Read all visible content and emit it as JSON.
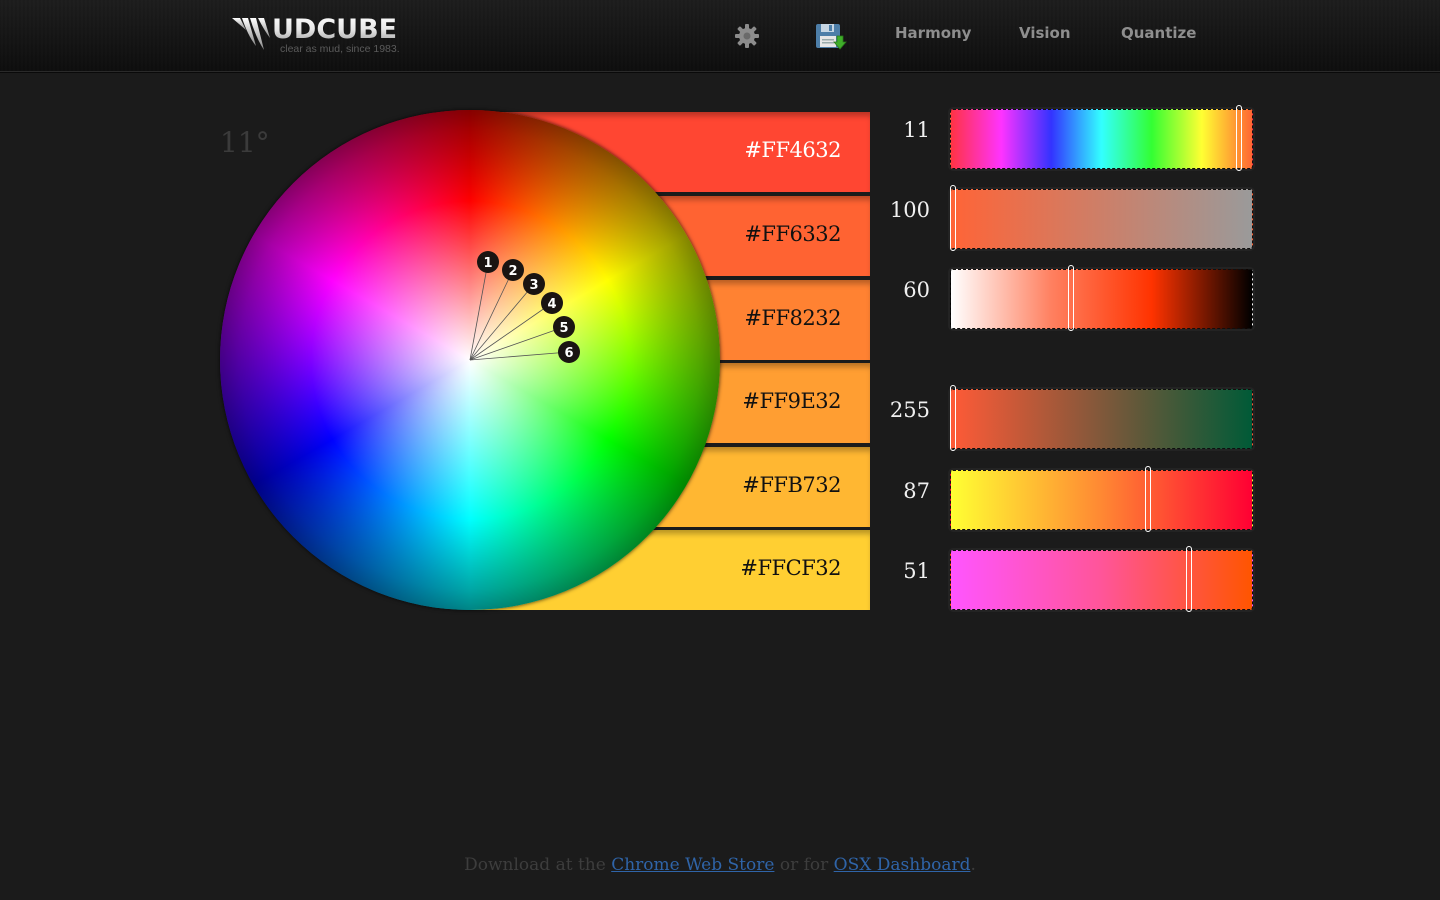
{
  "header": {
    "logo_text": "UDCUBE",
    "logo_tagline": "clear as mud, since 1983.",
    "icons": [
      {
        "name": "gear-icon",
        "label": "settings"
      },
      {
        "name": "save-icon",
        "label": "save / download"
      }
    ],
    "nav": [
      {
        "label": "Harmony"
      },
      {
        "label": "Vision"
      },
      {
        "label": "Quantize"
      }
    ]
  },
  "wheel": {
    "angle_label": "11°",
    "markers": [
      "1",
      "2",
      "3",
      "4",
      "5",
      "6"
    ]
  },
  "swatches": [
    {
      "hex": "#FF4632",
      "label_color": "#ffffff"
    },
    {
      "hex": "#FF6332",
      "label_color": "#111111"
    },
    {
      "hex": "#FF8232",
      "label_color": "#111111"
    },
    {
      "hex": "#FF9E32",
      "label_color": "#111111"
    },
    {
      "hex": "#FFB732",
      "label_color": "#111111"
    },
    {
      "hex": "#FFCF32",
      "label_color": "#111111"
    }
  ],
  "sliders": [
    {
      "name": "hue",
      "value": "11",
      "fraction": 0.97,
      "gradient": [
        "#ff3344",
        "#ff33ff",
        "#3333ff",
        "#33ffff",
        "#33ff33",
        "#ffff33",
        "#ff6633"
      ]
    },
    {
      "name": "saturation",
      "value": "100",
      "fraction": 0.0,
      "gradient": [
        "#ff6437",
        "#9a9a9a"
      ]
    },
    {
      "name": "lightness",
      "value": "60",
      "fraction": 0.4,
      "gradient": [
        "#ffffff",
        "#ff8060",
        "#ff3300",
        "#000000"
      ]
    },
    {
      "name": "red-green",
      "value": "255",
      "fraction": 0.0,
      "gradient": [
        "#ff5a37",
        "#80583a",
        "#005a37"
      ]
    },
    {
      "name": "yellow-red",
      "value": "87",
      "fraction": 0.66,
      "gradient": [
        "#ffff33",
        "#ff8833",
        "#ff0033"
      ]
    },
    {
      "name": "magenta-orange",
      "value": "51",
      "fraction": 0.8,
      "gradient": [
        "#ff55ff",
        "#ff5599",
        "#ff5500"
      ]
    }
  ],
  "footer": {
    "prefix": "Download at the ",
    "link1": "Chrome Web Store",
    "middle": " or for ",
    "link2": "OSX Dashboard",
    "suffix": "."
  }
}
